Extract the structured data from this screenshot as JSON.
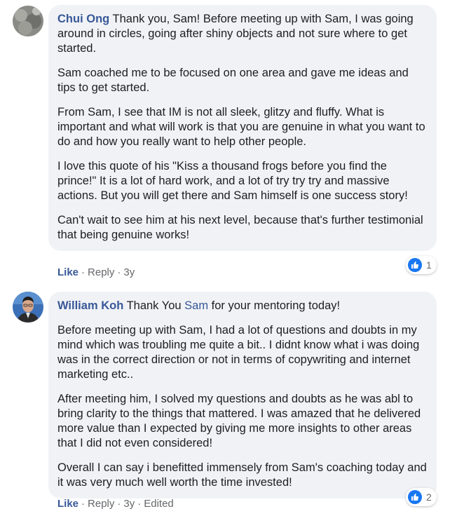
{
  "comments": [
    {
      "author": "Chui Ong",
      "intro": " Thank you, Sam! Before meeting up with Sam, I was going around in circles, going after shiny objects and not sure where to get started.",
      "paragraphs": [
        "Sam coached me to be focused on one area and gave me ideas and tips to get started.",
        "From Sam, I see that IM is not all sleek, glitzy and fluffy. What is important and what will work is that you are genuine in what you want to do and how you really want to help other people.",
        "I love this quote of his \"Kiss a thousand frogs before you find the prince!\" It is a lot of hard work, and a lot of try try try and massive actions. But you will get there and Sam himself is one success story!",
        "Can't wait to see him at his next level, because that's further testimonial that being genuine works!"
      ],
      "actions": {
        "like": "Like",
        "reply": "Reply",
        "time": "3y"
      },
      "reaction_count": "1"
    },
    {
      "author": "William Koh",
      "intro_before": " Thank You ",
      "mention": "Sam",
      "intro_after": " for your mentoring today!",
      "paragraphs": [
        "Before meeting up with Sam, I had a lot of questions and doubts in my mind which was troubling me quite a bit.. I didnt know what i was doing was in the correct direction or not in terms of copywriting and internet marketing etc..",
        "After meeting him, I solved my questions and doubts as he was abl to bring clarity to the things that mattered. I was amazed that he delivered more value than I expected by giving me more insights to other areas that I did not even considered!",
        "Overall I can say i benefitted immensely from Sam's coaching today and it was very much well worth the time invested!"
      ],
      "actions": {
        "like": "Like",
        "reply": "Reply",
        "time": "3y",
        "edited": "Edited"
      },
      "reaction_count": "2"
    }
  ],
  "icons": {
    "like_reaction": "thumbs-up-icon"
  },
  "colors": {
    "name": "#385898",
    "bubble": "#f0f2f5",
    "like_badge": "#1877f2",
    "meta": "#65676b"
  }
}
